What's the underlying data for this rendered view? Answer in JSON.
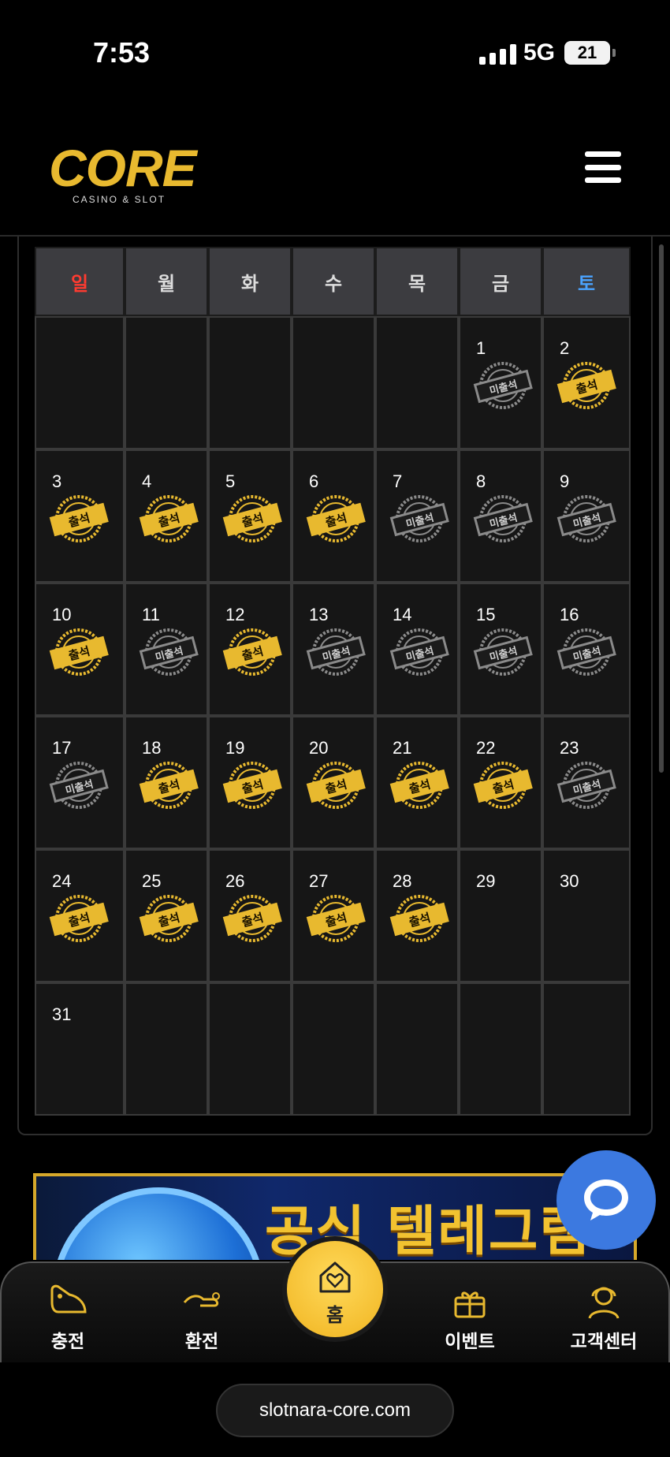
{
  "status_bar": {
    "time": "7:53",
    "network": "5G",
    "battery": "21"
  },
  "header": {
    "logo_text": "CORE",
    "logo_subtitle": "CASINO & SLOT"
  },
  "calendar": {
    "weekdays": [
      "일",
      "월",
      "화",
      "수",
      "목",
      "금",
      "토"
    ],
    "stamp_labels": {
      "attended": "출석",
      "absent": "미출석"
    },
    "days": [
      {
        "day": "",
        "status": ""
      },
      {
        "day": "",
        "status": ""
      },
      {
        "day": "",
        "status": ""
      },
      {
        "day": "",
        "status": ""
      },
      {
        "day": "",
        "status": ""
      },
      {
        "day": "1",
        "status": "absent"
      },
      {
        "day": "2",
        "status": "attended"
      },
      {
        "day": "3",
        "status": "attended"
      },
      {
        "day": "4",
        "status": "attended"
      },
      {
        "day": "5",
        "status": "attended"
      },
      {
        "day": "6",
        "status": "attended"
      },
      {
        "day": "7",
        "status": "absent"
      },
      {
        "day": "8",
        "status": "absent"
      },
      {
        "day": "9",
        "status": "absent"
      },
      {
        "day": "10",
        "status": "attended"
      },
      {
        "day": "11",
        "status": "absent"
      },
      {
        "day": "12",
        "status": "attended"
      },
      {
        "day": "13",
        "status": "absent"
      },
      {
        "day": "14",
        "status": "absent"
      },
      {
        "day": "15",
        "status": "absent"
      },
      {
        "day": "16",
        "status": "absent"
      },
      {
        "day": "17",
        "status": "absent"
      },
      {
        "day": "18",
        "status": "attended"
      },
      {
        "day": "19",
        "status": "attended"
      },
      {
        "day": "20",
        "status": "attended"
      },
      {
        "day": "21",
        "status": "attended"
      },
      {
        "day": "22",
        "status": "attended"
      },
      {
        "day": "23",
        "status": "absent"
      },
      {
        "day": "24",
        "status": "attended"
      },
      {
        "day": "25",
        "status": "attended"
      },
      {
        "day": "26",
        "status": "attended"
      },
      {
        "day": "27",
        "status": "attended"
      },
      {
        "day": "28",
        "status": "attended"
      },
      {
        "day": "29",
        "status": ""
      },
      {
        "day": "30",
        "status": ""
      },
      {
        "day": "31",
        "status": ""
      },
      {
        "day": "",
        "status": ""
      },
      {
        "day": "",
        "status": ""
      },
      {
        "day": "",
        "status": ""
      },
      {
        "day": "",
        "status": ""
      },
      {
        "day": "",
        "status": ""
      },
      {
        "day": "",
        "status": ""
      }
    ]
  },
  "banner": {
    "text": "공식 텔레그램"
  },
  "bottom_nav": {
    "deposit": "충전",
    "withdraw": "환전",
    "home": "홈",
    "event": "이벤트",
    "support": "고객센터"
  },
  "url": "slotnara-core.com",
  "colors": {
    "gold": "#e8b92f",
    "gray_stamp": "#8a8a8a",
    "sunday": "#ff3b30",
    "saturday": "#4aa3ff",
    "chat": "#3c79e0"
  }
}
